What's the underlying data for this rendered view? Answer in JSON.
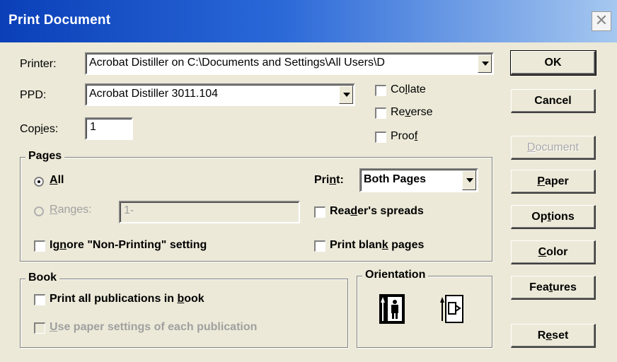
{
  "window": {
    "title": "Print Document",
    "close_glyph": "✕"
  },
  "printer": {
    "label_pre": "Printer:",
    "value": "Acrobat Distiller on C:\\Documents and Settings\\All Users\\D"
  },
  "ppd": {
    "label": "PPD:",
    "value": "Acrobat Distiller 3011.104"
  },
  "copies": {
    "label_pre": "Cop",
    "label_u": "i",
    "label_post": "es:",
    "value": "1"
  },
  "options": {
    "collate": {
      "pre": "Co",
      "u": "l",
      "post": "late",
      "checked": false
    },
    "reverse": {
      "pre": "Re",
      "u": "v",
      "post": "erse",
      "checked": false
    },
    "proof": {
      "pre": "Proo",
      "u": "f",
      "post": "",
      "checked": false
    }
  },
  "pages": {
    "title": "Pages",
    "all": {
      "pre": "",
      "u": "A",
      "post": "ll",
      "selected": true
    },
    "ranges": {
      "pre": "",
      "u": "R",
      "post": "anges:",
      "value": "1-",
      "enabled": false
    },
    "print": {
      "pre": "Pri",
      "u": "n",
      "post": "t:",
      "value": "Both Pages"
    },
    "readers_spreads": {
      "pre": "Rea",
      "u": "d",
      "post": "er's spreads",
      "checked": false
    },
    "ignore_nonprinting": {
      "pre": "Ig",
      "u": "n",
      "post": "ore \"Non-Printing\" setting",
      "checked": false
    },
    "print_blank": {
      "pre": "Print blan",
      "u": "k",
      "post": " pages",
      "checked": false
    }
  },
  "book": {
    "title": "Book",
    "print_all": {
      "pre": "Print all publications in ",
      "u": "b",
      "post": "ook",
      "checked": false
    },
    "use_paper": {
      "pre": "",
      "u": "U",
      "post": "se paper settings of each publication",
      "checked": false,
      "enabled": false
    }
  },
  "orientation": {
    "title": "Orientation",
    "portrait_icon": "portrait-page-icon",
    "landscape_icon": "landscape-page-icon"
  },
  "buttons": {
    "ok": "OK",
    "cancel": "Cancel",
    "document": {
      "pre": "",
      "u": "D",
      "post": "ocument",
      "enabled": false
    },
    "paper": {
      "pre": "",
      "u": "P",
      "post": "aper"
    },
    "options": {
      "pre": "Op",
      "u": "t",
      "post": "ions"
    },
    "color": {
      "pre": "",
      "u": "C",
      "post": "olor"
    },
    "features": {
      "pre": "Fea",
      "u": "t",
      "post": "ures"
    },
    "reset": {
      "pre": "R",
      "u": "e",
      "post": "set"
    }
  },
  "colors": {
    "title_start": "#0a3fb8",
    "title_end": "#a6c8f0",
    "dialog_bg": "#ece9d8"
  }
}
